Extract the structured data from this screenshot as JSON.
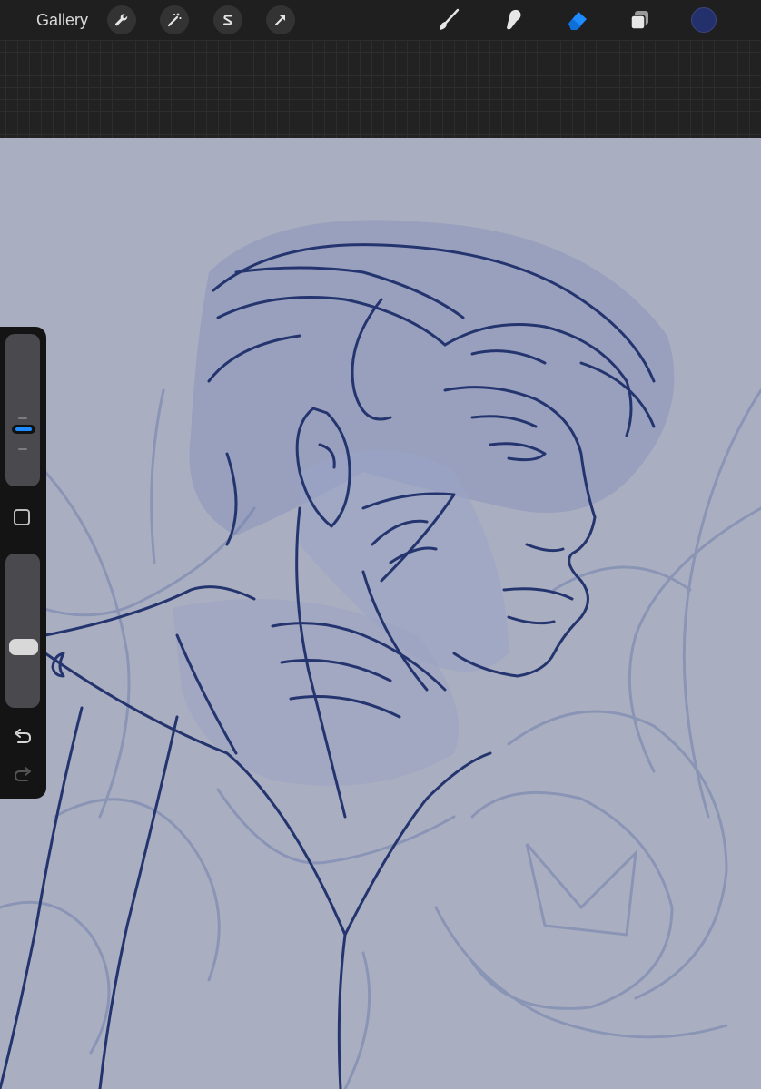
{
  "topbar": {
    "gallery_label": "Gallery",
    "actions": [
      {
        "icon": "wrench-icon",
        "name": "actions"
      },
      {
        "icon": "magic-wand-icon",
        "name": "adjustments"
      },
      {
        "icon": "selection-s-icon",
        "name": "selection"
      },
      {
        "icon": "arrow-cursor-icon",
        "name": "transform"
      }
    ],
    "tools": [
      {
        "icon": "brush-icon",
        "name": "paint"
      },
      {
        "icon": "smudge-icon",
        "name": "smudge"
      },
      {
        "icon": "eraser-icon",
        "name": "erase",
        "active": true
      },
      {
        "icon": "layers-icon",
        "name": "layers"
      }
    ],
    "current_color": "#23306b",
    "active_tool_color": "#1e8cff"
  },
  "sidebar": {
    "brush_size_slider": "size",
    "opacity_slider": "opacity",
    "modify_button": "square-icon",
    "undo_icon": "undo-icon",
    "redo_icon": "redo-icon"
  },
  "canvas": {
    "background": "#aaaec1",
    "sketch_color": "#6c7aa6",
    "line_color": "#24346e"
  }
}
